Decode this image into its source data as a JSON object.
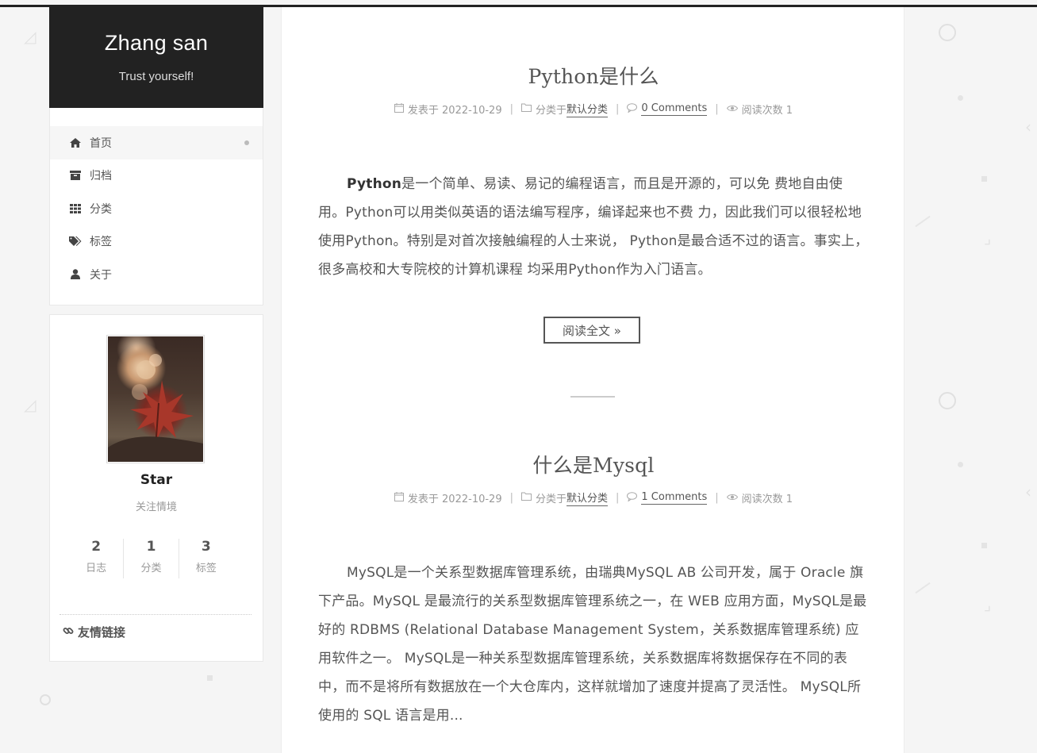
{
  "site": {
    "title": "Zhang san",
    "subtitle": "Trust yourself!"
  },
  "menu": {
    "items": [
      {
        "label": "首页",
        "icon": "home-icon",
        "active": true
      },
      {
        "label": "归档",
        "icon": "archive-icon",
        "active": false
      },
      {
        "label": "分类",
        "icon": "grid-icon",
        "active": false
      },
      {
        "label": "标签",
        "icon": "tags-icon",
        "active": false
      },
      {
        "label": "关于",
        "icon": "user-icon",
        "active": false
      }
    ]
  },
  "author": {
    "name": "Star",
    "motto": "关注情境",
    "stats": [
      {
        "count": "2",
        "label": "日志"
      },
      {
        "count": "1",
        "label": "分类"
      },
      {
        "count": "3",
        "label": "标签"
      }
    ],
    "links_title": "友情链接"
  },
  "posts": [
    {
      "title": "Python是什么",
      "posted_label": "发表于 2022-10-29",
      "category_prefix": "分类于",
      "category": "默认分类",
      "comments": "0 Comments",
      "views": "阅读次数 1",
      "body_bold": "Python",
      "body": "是一个简单、易读、易记的编程语言，而且是开源的，可以免 费地自由使用。Python可以用类似英语的语法编写程序，编译起来也不费 力，因此我们可以很轻松地使用Python。特别是对首次接触编程的人士来说， Python是最合适不过的语言。事实上，很多高校和大专院校的计算机课程 均采用Python作为入门语言。",
      "read_more": "阅读全文 »"
    },
    {
      "title": "什么是Mysql",
      "posted_label": "发表于 2022-10-29",
      "category_prefix": "分类于",
      "category": "默认分类",
      "comments": "1 Comments",
      "views": "阅读次数 1",
      "body": "MySQL是一个关系型数据库管理系统，由瑞典MySQL AB 公司开发，属于 Oracle 旗下产品。MySQL 是最流行的关系型数据库管理系统之一，在 WEB 应用方面，MySQL是最好的 RDBMS (Relational Database Management System，关系数据库管理系统) 应用软件之一。 MySQL是一种关系型数据库管理系统，关系数据库将数据保存在不同的表中，而不是将所有数据放在一个大仓库内，这样就增加了速度并提高了灵活性。 MySQL所使用的 SQL 语言是用..."
    }
  ]
}
